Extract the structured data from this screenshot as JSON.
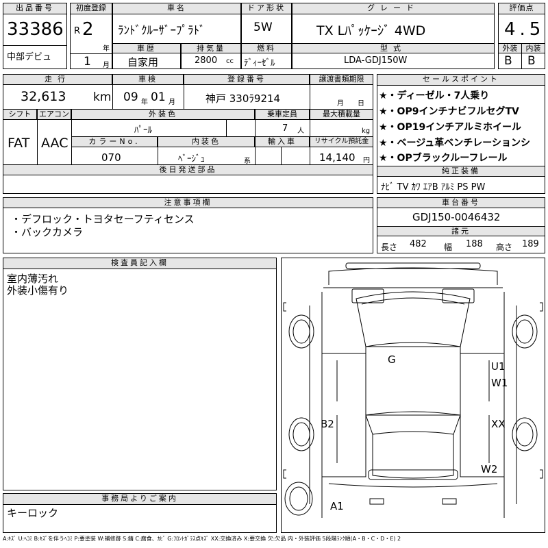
{
  "header": {
    "lot_label": "出品番号",
    "lot_number": "33386",
    "debut": "中部デビュ",
    "first_reg_label": "初度登録",
    "era": "R",
    "year_value": "2",
    "year_unit": "年",
    "month_value": "1",
    "month_unit": "月",
    "car_name_label": "車名",
    "car_name": "ﾗﾝﾄﾞｸﾙｰｻﾞｰﾌﾟﾗﾄﾞ",
    "door_label": "ドア形状",
    "door": "5W",
    "grade_label": "グレード",
    "grade": "TX Lﾊﾟｯｹｰｼﾞ 4WD",
    "history_label": "車歴",
    "history": "自家用",
    "displacement_label": "排気量",
    "displacement": "2800",
    "displacement_unit": "cc",
    "fuel_label": "燃料",
    "fuel": "ﾃﾞｨｰｾﾞﾙ",
    "model_label": "型式",
    "model": "LDA-GDJ150W",
    "score_label": "評価点",
    "score": "4.5",
    "exterior_label": "外装",
    "exterior": "B",
    "interior_label": "内装",
    "interior": "B"
  },
  "details": {
    "mileage_label": "走行",
    "mileage": "32,613",
    "mileage_unit": "km",
    "inspection_label": "車検",
    "inspection_year": "09",
    "inspection_year_unit": "年",
    "inspection_month": "01",
    "inspection_month_unit": "月",
    "registration_label": "登録番号",
    "registration": "神戸 330ﾗ9214",
    "transfer_label": "譲渡書類期限",
    "transfer_month_unit": "月",
    "transfer_day_unit": "日",
    "shift_label": "シフト",
    "shift": "FAT",
    "aircon_label": "エアコン",
    "aircon": "AAC",
    "ext_color_label": "外装色",
    "ext_color": "ﾊﾟｰﾙ",
    "capacity_label": "乗車定員",
    "capacity": "7",
    "capacity_unit": "人",
    "max_load_label": "最大積載量",
    "max_load_unit": "kg",
    "color_no_label": "カラーNo.",
    "color_no": "070",
    "int_color_label": "内装色",
    "int_color": "ﾍﾞｰｼﾞｭ",
    "int_color_suffix": "系",
    "import_label": "輸入車",
    "recycle_label": "リサイクル預託金",
    "recycle": "14,140",
    "recycle_unit": "円",
    "later_parts_label": "後日発送部品"
  },
  "sales_points": {
    "label": "セールスポイント",
    "items": [
      "★・ディーゼル・7人乗り",
      "★・OP9インチナビフルセグTV",
      "★・OP19インチアルミホイール",
      "★・ベージュ革ベンチレーションシ",
      "★・OPブラックルーフレール"
    ]
  },
  "equipment": {
    "label": "純正装備",
    "value": "ﾅﾋﾞ TV ｶﾜ ｴｱB ｱﾙﾐ PS PW"
  },
  "notes": {
    "label": "注意事項欄",
    "lines": [
      "・デフロック・トヨタセーフティセンス",
      "・バックカメラ"
    ]
  },
  "chassis": {
    "label": "車台番号",
    "value": "GDJ150-0046432",
    "dims_label": "諸元",
    "length_label": "長さ",
    "length": "482",
    "width_label": "幅",
    "width": "188",
    "height_label": "高さ",
    "height": "189"
  },
  "inspector": {
    "label": "検査員記入欄",
    "lines": [
      "室内薄汚れ",
      "外装小傷有り"
    ]
  },
  "office": {
    "label": "事務局よりご案内",
    "text": "キーロック"
  },
  "diagram_marks": {
    "g": "G",
    "u1": "U1",
    "w1": "W1",
    "b2": "B2",
    "xx": "XX",
    "w2": "W2",
    "a1": "A1"
  },
  "legend": "A:ｷｽﾞ U:ﾍｺﾐ B:ｷｽﾞを伴うﾍｺﾐ P:要塗装 W:補修跡 S:錆 C:腐食、ｶﾋﾞ G:ﾌﾛﾝﾄｶﾞﾗｽ点ｷｽﾞ XX:交換済み X:要交換 欠:欠品 内・外装評価 5段階ﾗﾝｸ順(A・B・C・D・E) 2"
}
